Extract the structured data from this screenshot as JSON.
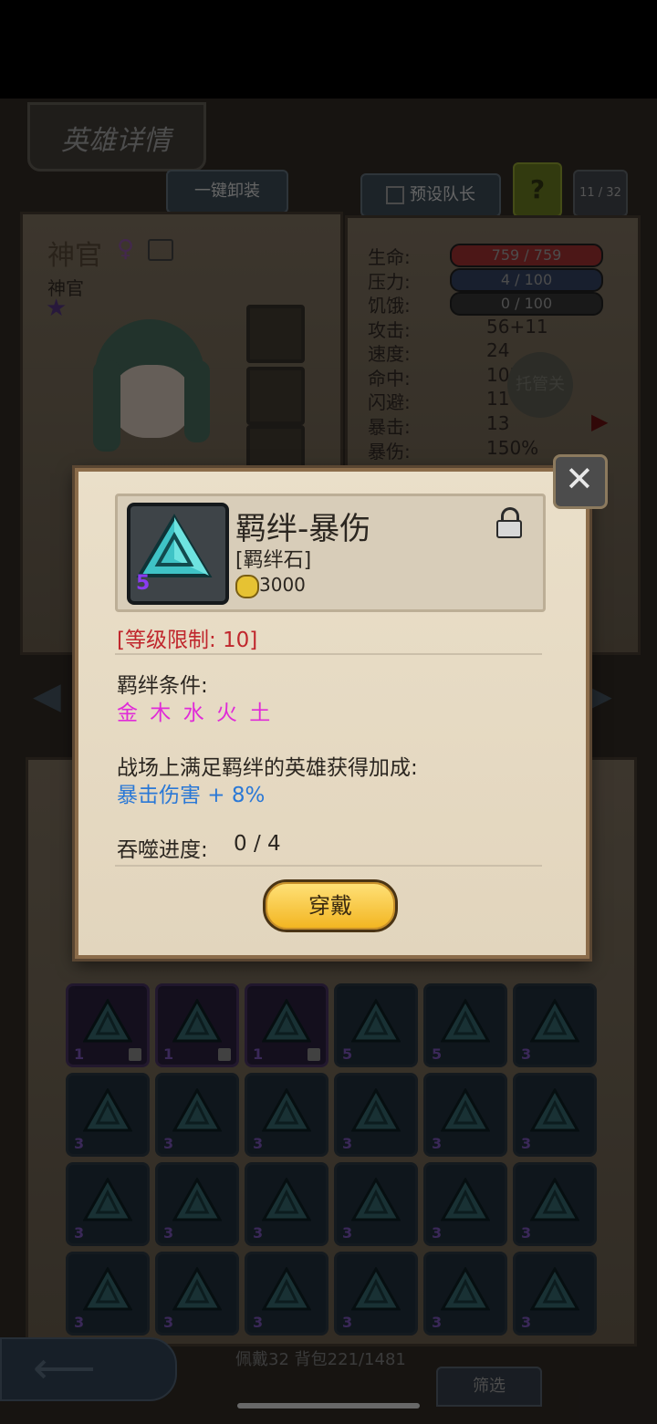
{
  "header": {
    "title": "英雄详情"
  },
  "top_buttons": {
    "unequip_all": "一键卸装",
    "preset_leader": "预设队长",
    "help": "?",
    "capacity": "11 / 32"
  },
  "hero": {
    "name": "神官",
    "class": "神官",
    "gender_icon": "female-icon"
  },
  "stats": [
    {
      "label": "生命:",
      "value": "759 / 759",
      "type": "bar",
      "color": "#8b2a2a"
    },
    {
      "label": "压力:",
      "value": "4 / 100",
      "type": "bar",
      "color": "#2c3a55"
    },
    {
      "label": "饥饿:",
      "value": "0 / 100",
      "type": "bar",
      "color": "#2e2e2e"
    },
    {
      "label": "攻击:",
      "value": "56+11"
    },
    {
      "label": "速度:",
      "value": "24"
    },
    {
      "label": "命中:",
      "value": "103"
    },
    {
      "label": "闪避:",
      "value": "11"
    },
    {
      "label": "暴击:",
      "value": "13"
    },
    {
      "label": "暴伤:",
      "value": "150%"
    }
  ],
  "auto_manage": "托管关",
  "dialog": {
    "item_name": "羁绊-暴伤",
    "item_type": "[羁绊石]",
    "item_level": "5",
    "price": "3000",
    "level_limit": "[等级限制: 10]",
    "bond_label": "羁绊条件:",
    "bond_elements": "金 木 水 火 土",
    "effect_label": "战场上满足羁绊的英雄获得加成:",
    "effect_value": "暴击伤害 + 8%",
    "devour_label": "吞噬进度:",
    "devour_value": "0 / 4",
    "equip_button": "穿戴",
    "colors": {
      "limit": "#c0272d",
      "elements": "#e02bd8",
      "effect": "#2a78d6",
      "text": "#2b2620"
    }
  },
  "inventory": {
    "cells": [
      {
        "level": "1",
        "locked": true,
        "purple": true
      },
      {
        "level": "1",
        "locked": true,
        "purple": true
      },
      {
        "level": "1",
        "locked": true,
        "purple": true
      },
      {
        "level": "5"
      },
      {
        "level": "5"
      },
      {
        "level": "3"
      },
      {
        "level": "3"
      },
      {
        "level": "3"
      },
      {
        "level": "3"
      },
      {
        "level": "3"
      },
      {
        "level": "3"
      },
      {
        "level": "3"
      },
      {
        "level": "3"
      },
      {
        "level": "3"
      },
      {
        "level": "3"
      },
      {
        "level": "3"
      },
      {
        "level": "3"
      },
      {
        "level": "3"
      },
      {
        "level": "3"
      },
      {
        "level": "3"
      },
      {
        "level": "3"
      },
      {
        "level": "3"
      },
      {
        "level": "3"
      },
      {
        "level": "3"
      }
    ],
    "footer": "佩戴32 背包221/1481",
    "filter_button": "筛选"
  }
}
